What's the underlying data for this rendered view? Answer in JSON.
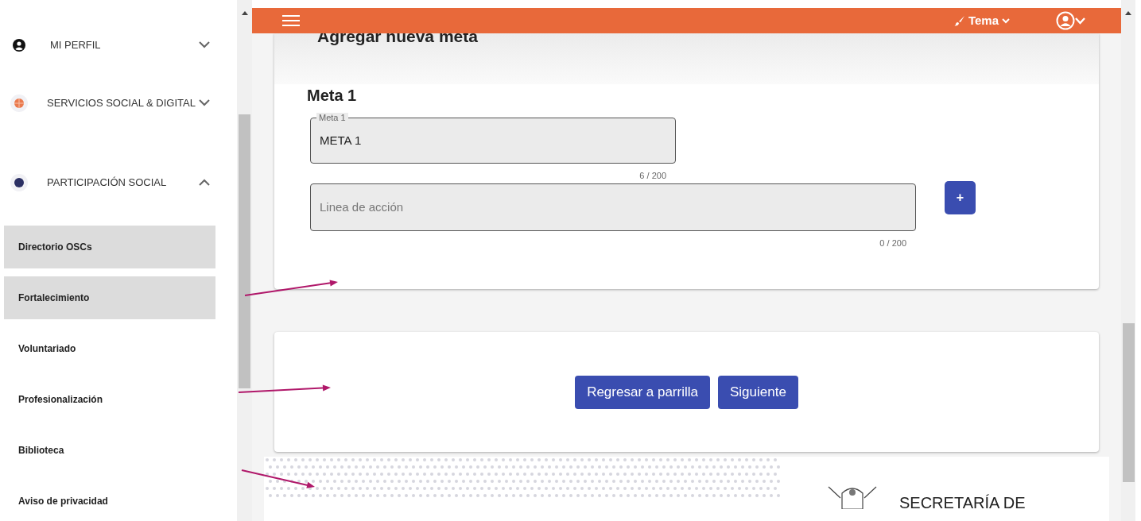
{
  "sidebar": {
    "sections": [
      {
        "label": "MI PERFIL",
        "expanded": false
      },
      {
        "label": "SERVICIOS SOCIAL & DIGITAL",
        "expanded": false
      },
      {
        "label": "PARTICIPACIÓN SOCIAL",
        "expanded": true
      }
    ],
    "items": [
      {
        "label": "Directorio OSCs",
        "selected": true
      },
      {
        "label": "Fortalecimiento",
        "selected": true
      },
      {
        "label": "Voluntariado",
        "selected": false
      },
      {
        "label": "Profesionalización",
        "selected": false
      },
      {
        "label": "Biblioteca",
        "selected": false
      },
      {
        "label": "Aviso de privacidad",
        "selected": false
      }
    ]
  },
  "header": {
    "theme_label": "Tema"
  },
  "page_title": "Agregar nueva meta",
  "goal": {
    "heading": "Meta 1",
    "field_label": "Meta 1",
    "value": "META 1",
    "counter": "6 / 200",
    "action_placeholder": "Linea de acción",
    "action_counter": "0 / 200",
    "add_label": "+"
  },
  "buttons": [
    "Regresar a parrilla",
    "Siguiente"
  ],
  "footer": {
    "agency": "SECRETARÍA DE"
  }
}
